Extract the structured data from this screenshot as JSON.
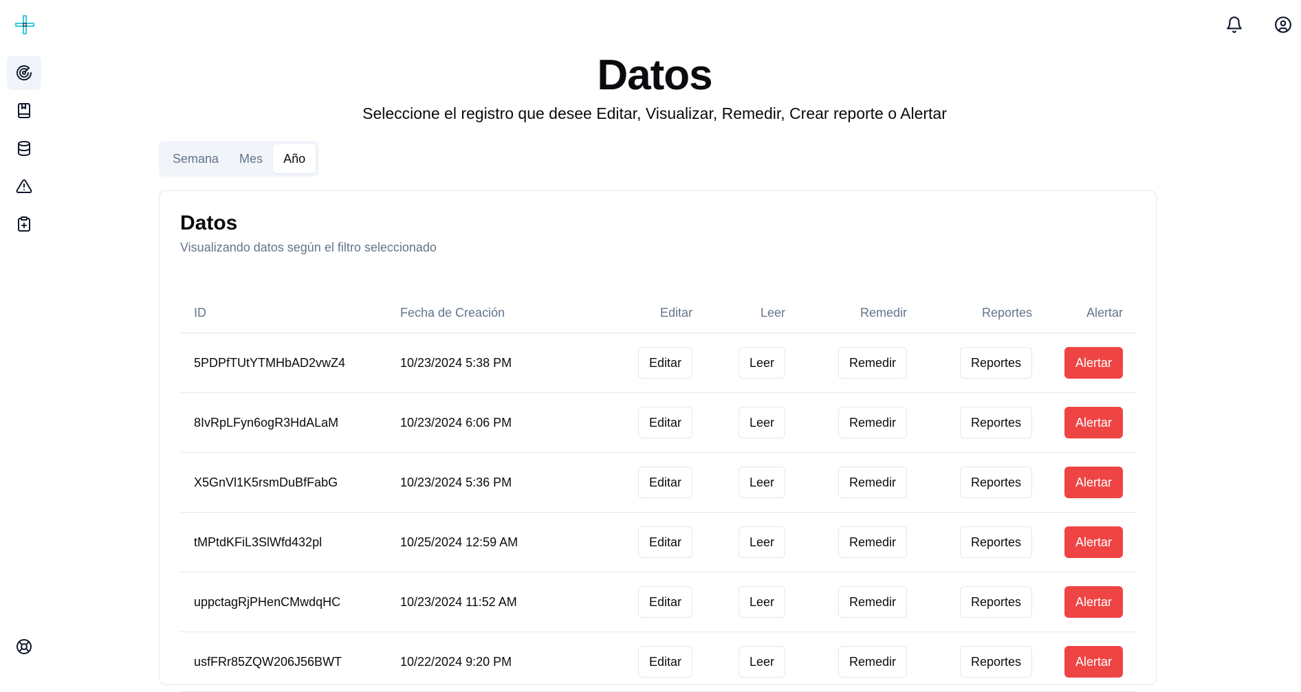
{
  "header": {
    "title": "Datos",
    "subtitle": "Seleccione el registro que desee Editar, Visualizar, Remedir, Crear reporte o Alertar"
  },
  "sidebar": {
    "items": [
      {
        "icon": "radar-icon",
        "active": true
      },
      {
        "icon": "book-icon",
        "active": false
      },
      {
        "icon": "database-icon",
        "active": false
      },
      {
        "icon": "alert-triangle-icon",
        "active": false
      },
      {
        "icon": "clipboard-plus-icon",
        "active": false
      }
    ],
    "bottom_icon": "life-buoy-icon"
  },
  "topbar": {
    "icons": [
      "bell-icon",
      "user-circle-icon"
    ]
  },
  "tabs": [
    {
      "label": "Semana",
      "active": false
    },
    {
      "label": "Mes",
      "active": false
    },
    {
      "label": "Año",
      "active": true
    }
  ],
  "card": {
    "title": "Datos",
    "description": "Visualizando datos según el filtro seleccionado"
  },
  "table": {
    "headers": {
      "id": "ID",
      "date": "Fecha de Creación",
      "edit": "Editar",
      "read": "Leer",
      "remeasure": "Remedir",
      "reports": "Reportes",
      "alert": "Alertar"
    },
    "rows": [
      {
        "id": "5PDPfTUtYTMHbAD2vwZ4",
        "date": "10/23/2024 5:38 PM"
      },
      {
        "id": "8IvRpLFyn6ogR3HdALaM",
        "date": "10/23/2024 6:06 PM"
      },
      {
        "id": "X5GnVl1K5rsmDuBfFabG",
        "date": "10/23/2024 5:36 PM"
      },
      {
        "id": "tMPtdKFiL3SlWfd432pl",
        "date": "10/25/2024 12:59 AM"
      },
      {
        "id": "uppctagRjPHenCMwdqHC",
        "date": "10/23/2024 11:52 AM"
      },
      {
        "id": "usfFRr85ZQW206J56BWT",
        "date": "10/22/2024 9:20 PM"
      }
    ],
    "buttons": {
      "edit": "Editar",
      "read": "Leer",
      "remeasure": "Remedir",
      "reports": "Reportes",
      "alert": "Alertar"
    }
  },
  "colors": {
    "alert_button": "#ef4444",
    "muted_text": "#64748b",
    "border": "#e2e8f0",
    "logo_accent": "#22c5d8"
  }
}
